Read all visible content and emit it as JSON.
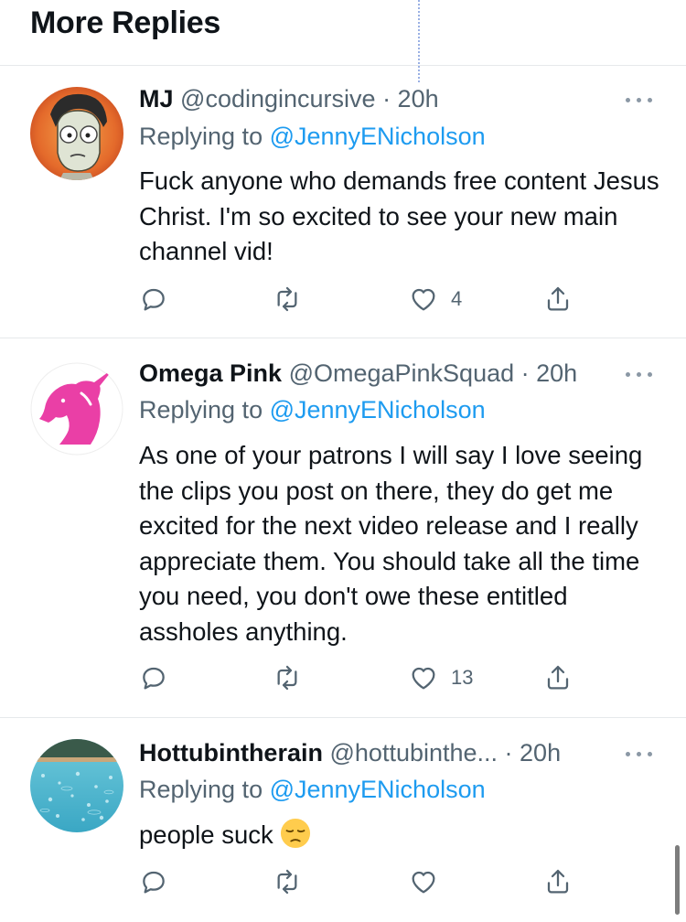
{
  "section": {
    "title": "More Replies"
  },
  "tweets": [
    {
      "name": "MJ",
      "handle": "@codingincursive",
      "time": "· 20h",
      "replying_prefix": "Replying to ",
      "replying_handle": "@JennyENicholson",
      "text": "Fuck anyone who demands free content Jesus Christ. I'm so excited to see your new main channel vid!",
      "likes": "4",
      "avatar": "cartoon-face-avatar"
    },
    {
      "name": "Omega Pink",
      "handle": "@OmegaPinkSquad",
      "time": "· 20h",
      "replying_prefix": "Replying to ",
      "replying_handle": "@JennyENicholson",
      "text": "As one of your patrons I will say I love seeing the clips you post on there, they do get me excited for the next video release and I really appreciate them.  You should take all the time you need, you don't owe these entitled assholes anything.",
      "likes": "13",
      "avatar": "pink-unicorn-avatar"
    },
    {
      "name": "Hottubintherain",
      "handle": "@hottubinthe...",
      "time": "· 20h",
      "replying_prefix": "Replying to ",
      "replying_handle": "@JennyENicholson",
      "text": "people suck",
      "likes": "",
      "emoji": "pensive-face",
      "avatar": "rainy-pool-avatar"
    }
  ],
  "colors": {
    "link": "#1d9bf0",
    "secondary_text": "#536471",
    "primary_text": "#0f1419",
    "unicorn": "#ea3fa6"
  },
  "icons": [
    "reply-icon",
    "retweet-icon",
    "like-icon",
    "share-icon",
    "more-icon"
  ]
}
